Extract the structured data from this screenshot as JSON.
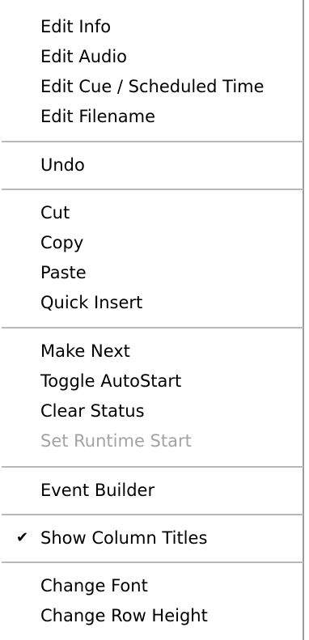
{
  "menu": {
    "groups": [
      {
        "items": [
          {
            "label": "Edit Info",
            "enabled": true
          },
          {
            "label": "Edit Audio",
            "enabled": true
          },
          {
            "label": "Edit Cue / Scheduled Time",
            "enabled": true
          },
          {
            "label": "Edit Filename",
            "enabled": true
          }
        ]
      },
      {
        "items": [
          {
            "label": "Undo",
            "enabled": true
          }
        ]
      },
      {
        "items": [
          {
            "label": "Cut",
            "enabled": true
          },
          {
            "label": "Copy",
            "enabled": true
          },
          {
            "label": "Paste",
            "enabled": true
          },
          {
            "label": "Quick Insert",
            "enabled": true
          }
        ]
      },
      {
        "items": [
          {
            "label": "Make Next",
            "enabled": true
          },
          {
            "label": "Toggle AutoStart",
            "enabled": true
          },
          {
            "label": "Clear Status",
            "enabled": true
          },
          {
            "label": "Set Runtime Start",
            "enabled": false
          }
        ]
      },
      {
        "items": [
          {
            "label": "Event Builder",
            "enabled": true
          }
        ]
      },
      {
        "items": [
          {
            "label": "Show Column Titles",
            "enabled": true,
            "checked": true,
            "check_icon": "checkmark-icon"
          }
        ]
      },
      {
        "items": [
          {
            "label": "Change Font",
            "enabled": true
          },
          {
            "label": "Change Row Height",
            "enabled": true
          }
        ]
      }
    ]
  }
}
